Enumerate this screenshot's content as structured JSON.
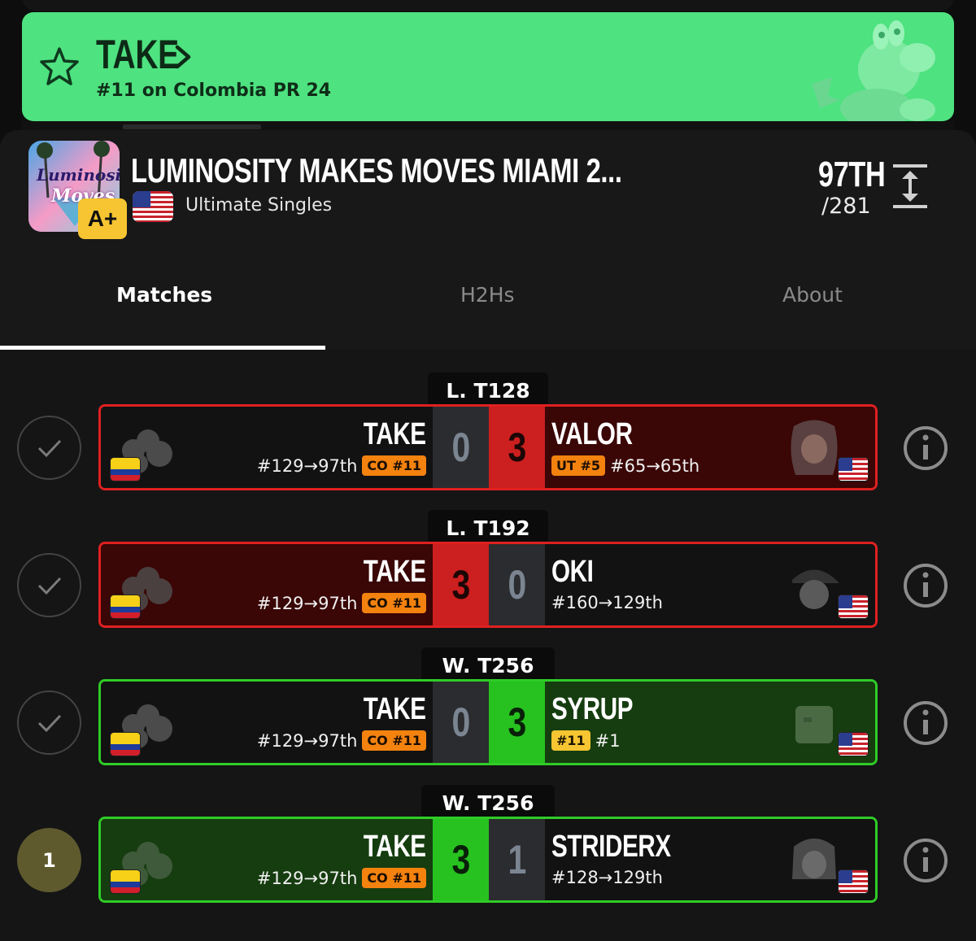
{
  "banner": {
    "player_name": "TAKE",
    "subtitle": "#11 on Colombia PR 24",
    "color": "#4ee280"
  },
  "tournament": {
    "title": "LUMINOSITY MAKES MOVES MIAMI 2...",
    "grade": "A+",
    "event": "Ultimate Singles",
    "placement": "97TH",
    "entrants": "/281",
    "logo_text_1": "Luminosity",
    "logo_text_2": "Moves"
  },
  "tabs": [
    {
      "label": "Matches",
      "active": true
    },
    {
      "label": "H2Hs",
      "active": false
    },
    {
      "label": "About",
      "active": false
    }
  ],
  "matches": [
    {
      "round": "L. T128",
      "result": "loss",
      "player": {
        "name": "TAKE",
        "seed": "#129→97th",
        "badge": "CO #11"
      },
      "player_score": "0",
      "opponent": {
        "name": "VALOR",
        "seed": "#65→65th",
        "badge": "UT #5"
      },
      "opponent_score": "3",
      "status": "check"
    },
    {
      "round": "L. T192",
      "result": "win",
      "player": {
        "name": "TAKE",
        "seed": "#129→97th",
        "badge": "CO #11"
      },
      "player_score": "3",
      "opponent": {
        "name": "OKI",
        "seed": "#160→129th",
        "badge": ""
      },
      "opponent_score": "0",
      "status": "check"
    },
    {
      "round": "W. T256",
      "result": "loss",
      "player": {
        "name": "TAKE",
        "seed": "#129→97th",
        "badge": "CO #11"
      },
      "player_score": "0",
      "opponent": {
        "name": "SYRUP",
        "seed": "#1",
        "badge": "#11"
      },
      "opponent_score": "3",
      "status": "check"
    },
    {
      "round": "W. T256",
      "result": "win",
      "player": {
        "name": "TAKE",
        "seed": "#129→97th",
        "badge": "CO #11"
      },
      "player_score": "3",
      "opponent": {
        "name": "STRIDERX",
        "seed": "#128→129th",
        "badge": ""
      },
      "opponent_score": "1",
      "status": "1"
    }
  ],
  "colors": {
    "loss_red": "#cc1f1f",
    "win_green": "#27c21f",
    "loss_card": "#3a0606",
    "win_card": "#163d10",
    "badge_orange": "#f3820f",
    "badge_yellow": "#f6c531"
  },
  "icons": {
    "banner": "star-icon",
    "expand": "expand-vertical-icon",
    "status": "check-icon",
    "info": "info-icon"
  }
}
